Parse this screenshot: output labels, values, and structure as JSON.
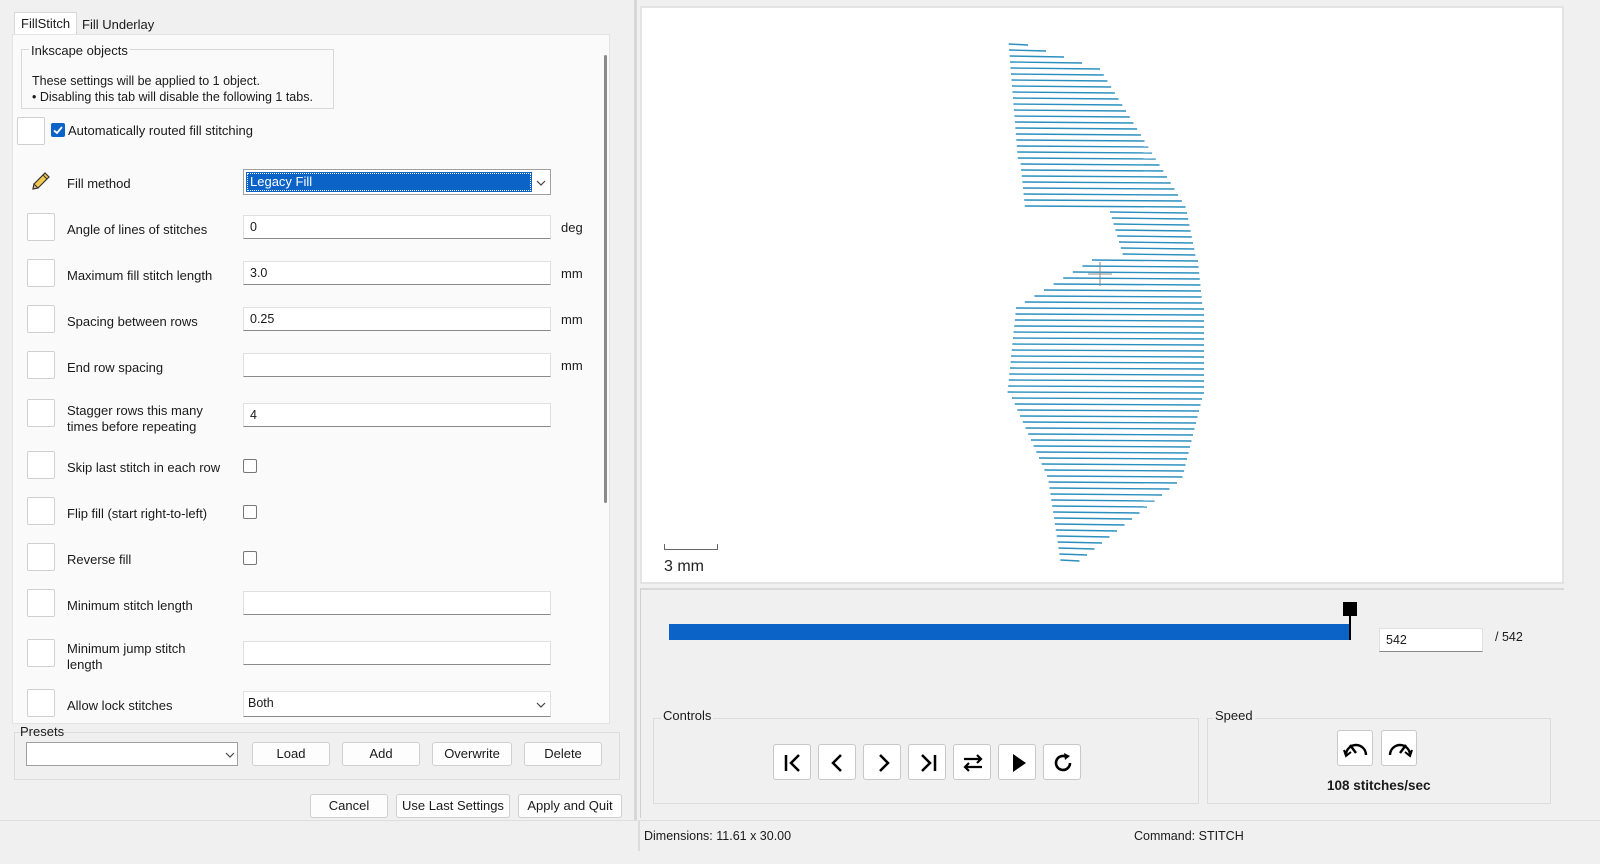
{
  "tabs": [
    {
      "label": "FillStitch"
    },
    {
      "label": "Fill Underlay"
    }
  ],
  "info": {
    "title": "Inkscape objects",
    "line1": "These settings will be applied to 1 object.",
    "line2": "• Disabling this tab will disable the following 1 tabs."
  },
  "auto_fill": {
    "label": "Automatically routed fill stitching",
    "checked": true
  },
  "params": {
    "fill_method": {
      "label": "Fill method",
      "value": "Legacy Fill"
    },
    "angle": {
      "label": "Angle of lines of stitches",
      "value": "0",
      "unit": "deg"
    },
    "max_len": {
      "label": "Maximum fill stitch length",
      "value": "3.0",
      "unit": "mm"
    },
    "spacing": {
      "label": "Spacing between rows",
      "value": "0.25",
      "unit": "mm"
    },
    "end_spacing": {
      "label": "End row spacing",
      "value": "",
      "unit": "mm"
    },
    "stagger": {
      "label_line1": "Stagger rows this many",
      "label_line2": "times before repeating",
      "value": "4"
    },
    "skip_last": {
      "label": "Skip last stitch in each row"
    },
    "flip_fill": {
      "label": "Flip fill (start right-to-left)"
    },
    "reverse_fill": {
      "label": "Reverse fill"
    },
    "min_stitch": {
      "label": "Minimum stitch length",
      "value": ""
    },
    "min_jump": {
      "label_line1": "Minimum jump stitch",
      "label_line2": "length",
      "value": ""
    },
    "lock": {
      "label": "Allow lock stitches",
      "value": "Both"
    }
  },
  "presets": {
    "title": "Presets",
    "load": "Load",
    "add": "Add",
    "overwrite": "Overwrite",
    "delete": "Delete"
  },
  "actions": {
    "cancel": "Cancel",
    "use_last": "Use Last Settings",
    "apply_quit": "Apply and Quit"
  },
  "preview": {
    "scale_label": "3 mm"
  },
  "progress": {
    "current": "542",
    "total": "/ 542",
    "fraction": 1.0
  },
  "controls": {
    "title": "Controls"
  },
  "speed": {
    "title": "Speed",
    "value": "108 stitches/sec"
  },
  "status": {
    "dimensions": "Dimensions: 11.61 x 30.00",
    "command": "Command: STITCH"
  },
  "colors": {
    "accent": "#0b63c8",
    "stitch": "#2a8fbf"
  }
}
